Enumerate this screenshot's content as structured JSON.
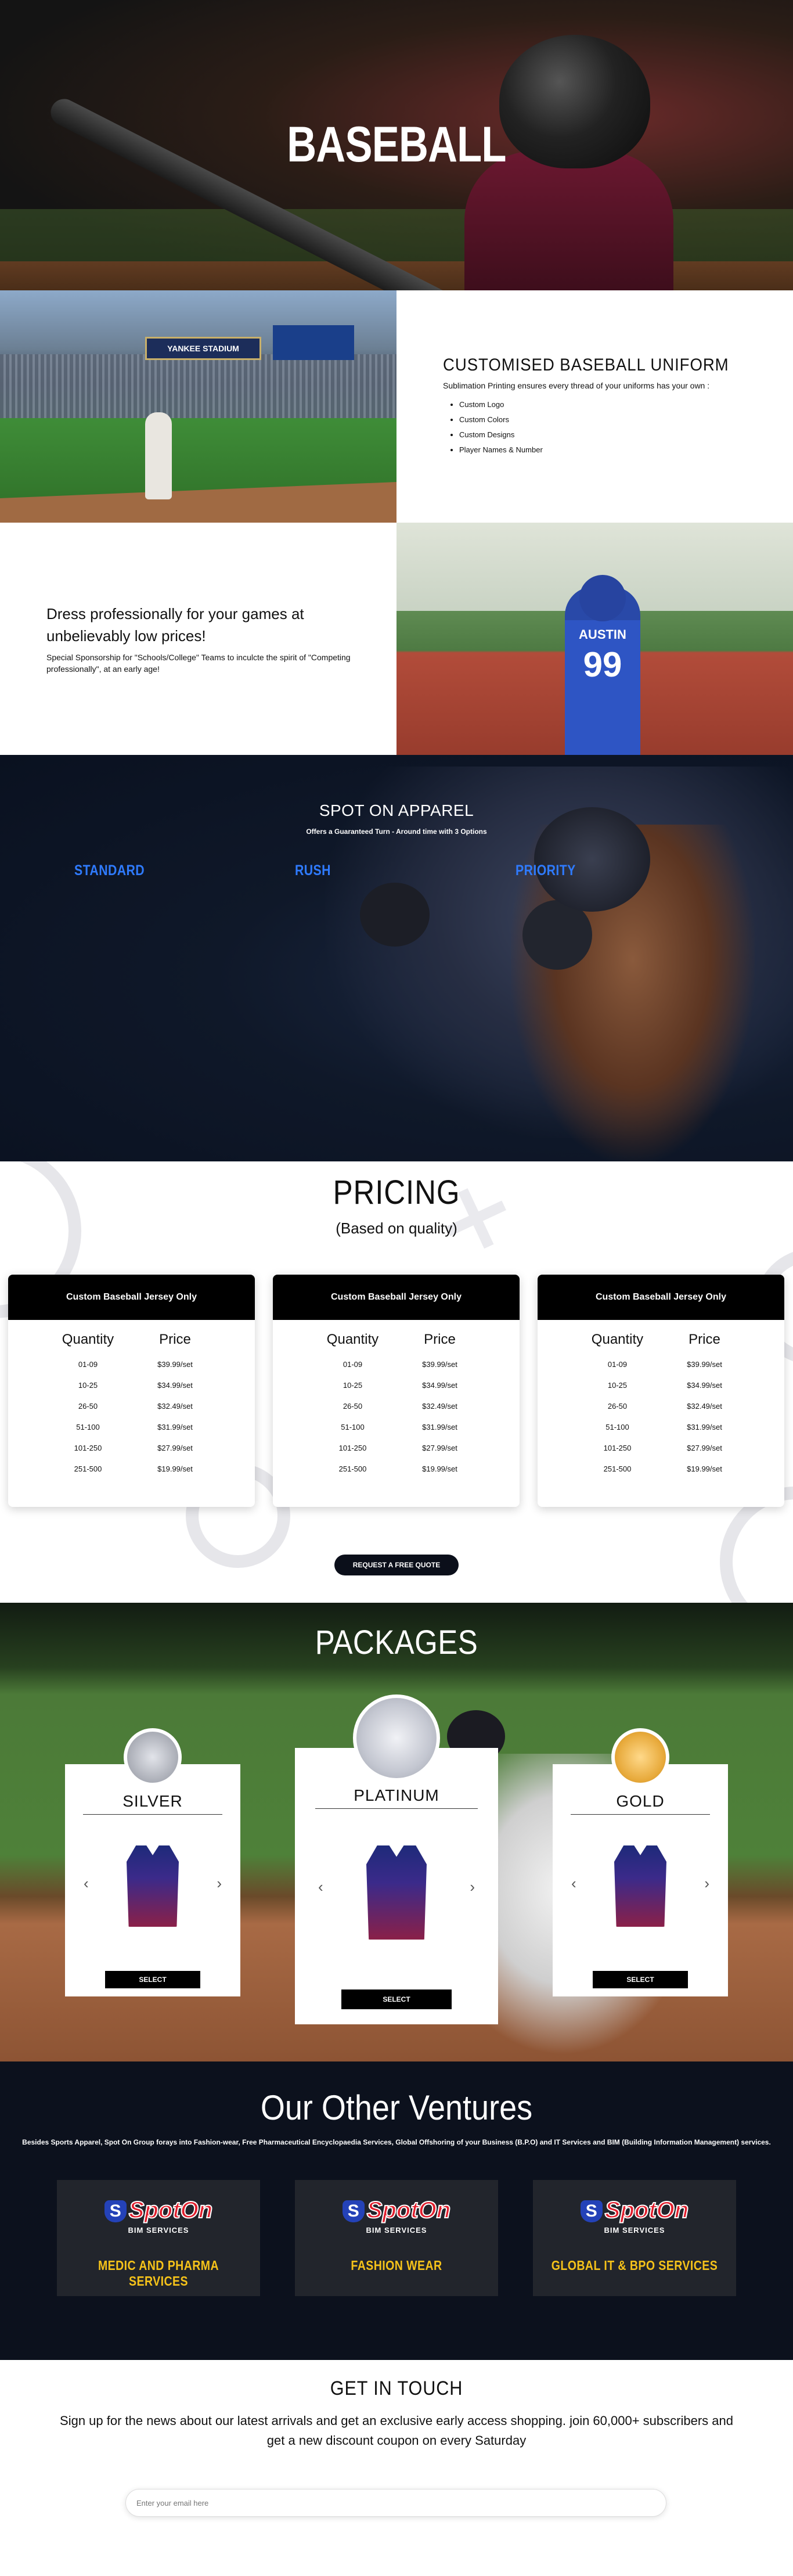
{
  "hero": {
    "title": "BASEBALL"
  },
  "uniform": {
    "title": "CUSTOMISED BASEBALL UNIFORM",
    "intro": "Sublimation Printing ensures every thread of your uniforms has your own :",
    "items": [
      "Custom Logo",
      "Custom Colors",
      "Custom Designs",
      "Player Names & Number"
    ]
  },
  "dress": {
    "title": "Dress professionally for your games at unbelievably low prices!",
    "text": "Special Sponsorship for \"Schools/College\" Teams to inculcte the spirit of \"Competing professionally\", at an early age!"
  },
  "kid_photo": {
    "name": "AUSTIN",
    "number": "99"
  },
  "stadium_photo": {
    "board": "YANKEE STADIUM"
  },
  "apparel": {
    "title": "SPOT ON APPAREL",
    "subtitle": "Offers a Guaranteed Turn - Around time with 3 Options",
    "options": [
      {
        "title": "STANDARD",
        "line1": "",
        "line2": ""
      },
      {
        "title": "RUSH",
        "line1": "",
        "line2": ""
      },
      {
        "title": "PRIORITY",
        "line1": "",
        "line2": ""
      }
    ]
  },
  "pricing": {
    "title": "PRICING",
    "subtitle": "(Based on quality)",
    "cards": [
      {
        "header": "Custom Baseball Jersey Only",
        "col_qty": "Quantity",
        "col_price": "Price",
        "rows": [
          {
            "q": "01-09",
            "p": "$39.99/set"
          },
          {
            "q": "10-25",
            "p": "$34.99/set"
          },
          {
            "q": "26-50",
            "p": "$32.49/set"
          },
          {
            "q": "51-100",
            "p": "$31.99/set"
          },
          {
            "q": "101-250",
            "p": "$27.99/set"
          },
          {
            "q": "251-500",
            "p": "$19.99/set"
          }
        ]
      },
      {
        "header": "Custom Baseball Jersey Only",
        "col_qty": "Quantity",
        "col_price": "Price",
        "rows": [
          {
            "q": "01-09",
            "p": "$39.99/set"
          },
          {
            "q": "10-25",
            "p": "$34.99/set"
          },
          {
            "q": "26-50",
            "p": "$32.49/set"
          },
          {
            "q": "51-100",
            "p": "$31.99/set"
          },
          {
            "q": "101-250",
            "p": "$27.99/set"
          },
          {
            "q": "251-500",
            "p": "$19.99/set"
          }
        ]
      },
      {
        "header": "Custom Baseball Jersey Only",
        "col_qty": "Quantity",
        "col_price": "Price",
        "rows": [
          {
            "q": "01-09",
            "p": "$39.99/set"
          },
          {
            "q": "10-25",
            "p": "$34.99/set"
          },
          {
            "q": "26-50",
            "p": "$32.49/set"
          },
          {
            "q": "51-100",
            "p": "$31.99/set"
          },
          {
            "q": "101-250",
            "p": "$27.99/set"
          },
          {
            "q": "251-500",
            "p": "$19.99/set"
          }
        ]
      }
    ],
    "quote_button": "REQUEST A FREE QUOTE"
  },
  "packages": {
    "title": "PACKAGES",
    "items": [
      {
        "name": "SILVER",
        "select": "SELECT",
        "medal_color": "#b9bcc4"
      },
      {
        "name": "PLATINUM",
        "select": "SELECT",
        "medal_color": "#c9ccd6"
      },
      {
        "name": "GOLD",
        "select": "SELECT",
        "medal_color": "#e7a93a"
      }
    ],
    "prev_icon": "chevron-left-icon",
    "next_icon": "chevron-right-icon"
  },
  "ventures": {
    "title": "Our Other Ventures",
    "subtitle": "Besides Sports Apparel, Spot On Group forays into Fashion-wear, Free Pharmaceutical Encyclopaedia Services, Global Offshoring of your Business (B.P.O) and IT Services and BIM (Building Information Management) services.",
    "cards": [
      {
        "logo_mark": "S",
        "logo": "SpotOn",
        "sub": "BIM SERVICES",
        "label": "MEDIC AND PHARMA SERVICES"
      },
      {
        "logo_mark": "S",
        "logo": "SpotOn",
        "sub": "BIM SERVICES",
        "label": "FASHION WEAR"
      },
      {
        "logo_mark": "S",
        "logo": "SpotOn",
        "sub": "BIM SERVICES",
        "label": "GLOBAL IT & BPO SERVICES"
      }
    ]
  },
  "contact": {
    "title": "GET IN TOUCH",
    "text": "Sign up for the news about our latest arrivals and get an exclusive early access shopping. join 60,000+ subscribers and get a new discount coupon on every Saturday",
    "email_placeholder": "Enter your email here"
  },
  "colors": {
    "accent_blue": "#2f7bff",
    "gold_label": "#f5c21a",
    "dark_bg": "#0c111d"
  }
}
